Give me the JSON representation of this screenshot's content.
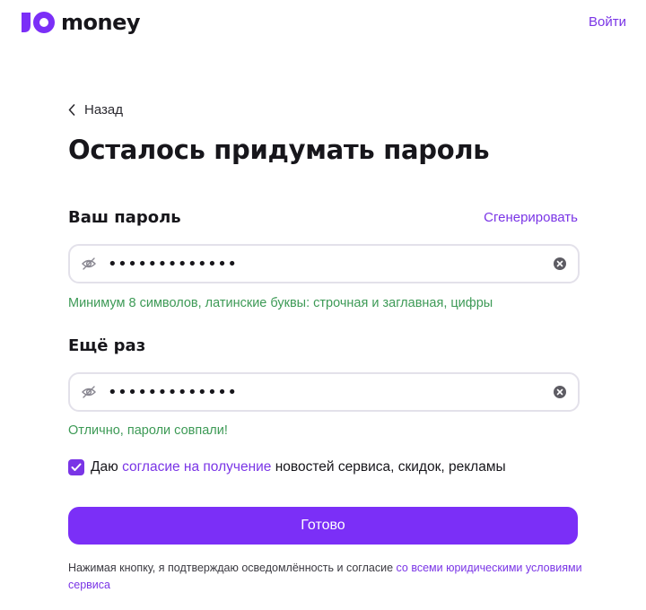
{
  "header": {
    "brand": "money",
    "login_label": "Войти"
  },
  "nav": {
    "back_label": "Назад"
  },
  "page": {
    "title": "Осталось придумать пароль"
  },
  "password": {
    "label": "Ваш пароль",
    "generate_label": "Сгенерировать",
    "value": "•••••••••••••",
    "hint": "Минимум 8 символов, латинские буквы: строчная и заглавная, цифры"
  },
  "repeat": {
    "label": "Ещё раз",
    "value": "•••••••••••••",
    "hint": "Отлично, пароли совпали!"
  },
  "consent": {
    "checked": true,
    "prefix": "Даю",
    "link": "согласие на получение",
    "suffix": "новостей сервиса, скидок, рекламы"
  },
  "submit": {
    "label": "Готово"
  },
  "legal": {
    "text": "Нажимая кнопку, я подтверждаю осведомлённость и согласие",
    "link": "со всеми юридическими условиями сервиса"
  },
  "colors": {
    "accent": "#7b2ff7",
    "link": "#7a35e6",
    "success": "#3d9a56"
  },
  "icons": [
    "yoomoney-logo-icon",
    "chevron-left-icon",
    "eye-crossed-icon",
    "clear-circle-icon",
    "checkmark-icon"
  ]
}
